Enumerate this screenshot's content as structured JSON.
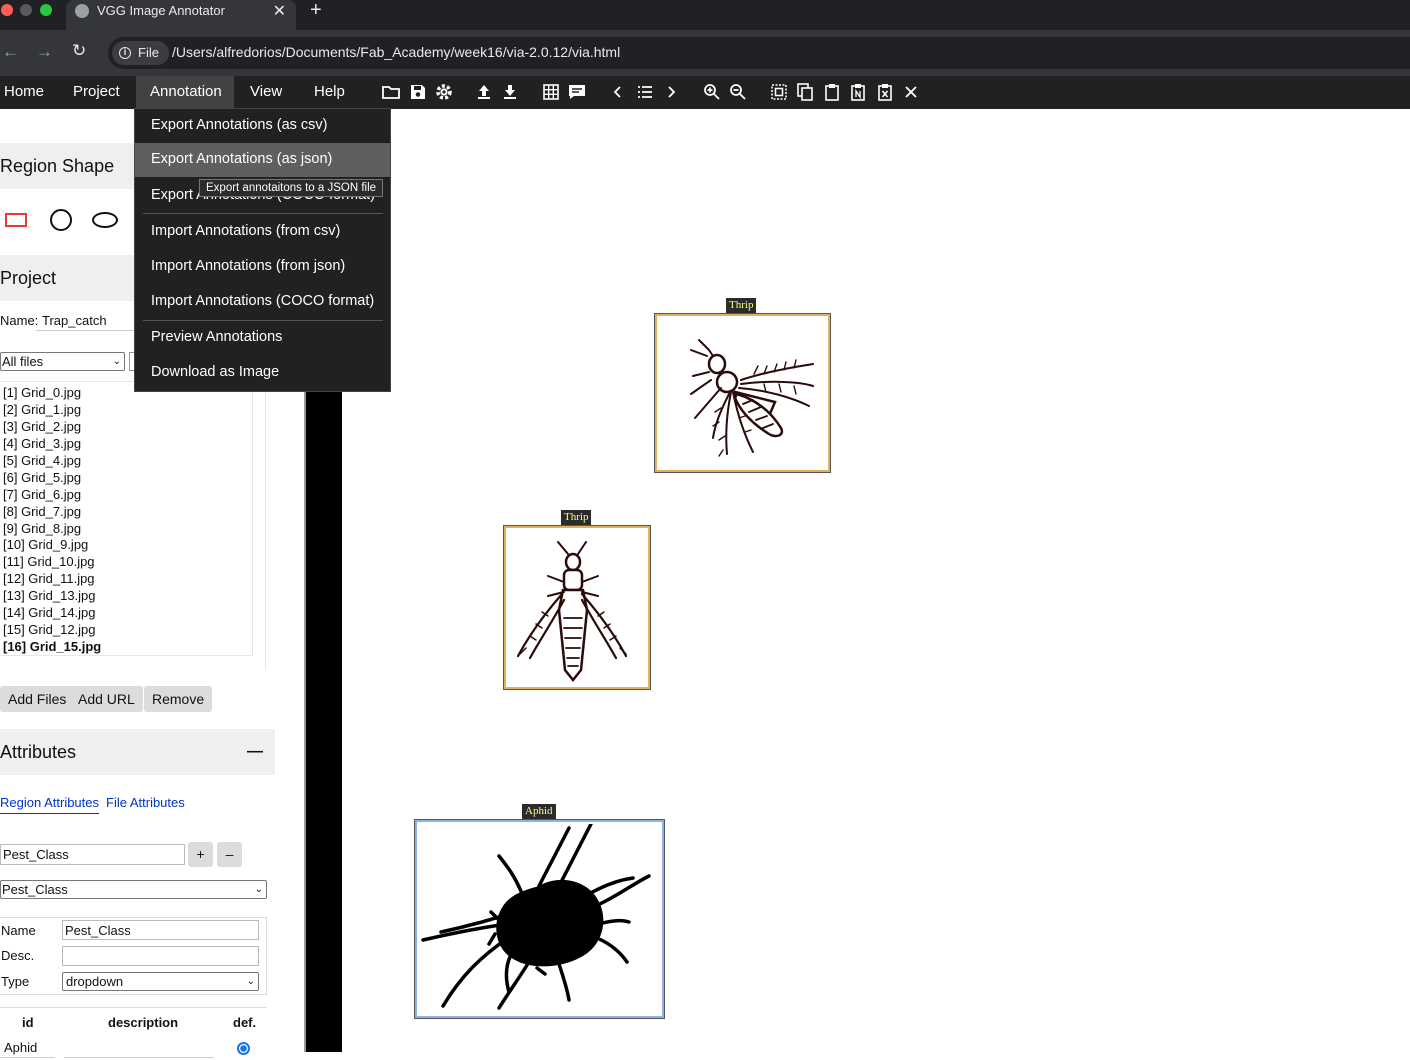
{
  "browser": {
    "tab_title": "VGG Image Annotator",
    "new_tab": "+",
    "file_chip": "File",
    "url": "/Users/alfredorios/Documents/Fab_Academy/week16/via-2.0.12/via.html"
  },
  "nav": {
    "items": [
      "Home",
      "Project",
      "Annotation",
      "View",
      "Help"
    ],
    "active": "Annotation"
  },
  "toolbar_icons": [
    "folder-open-icon",
    "save-icon",
    "settings-icon",
    "upload-icon",
    "download-icon",
    "grid-icon",
    "comment-icon",
    "prev-icon",
    "list-icon",
    "next-icon",
    "zoom-in-icon",
    "zoom-out-icon",
    "select-all-icon",
    "copy-icon",
    "paste-icon",
    "paste-n-icon",
    "delete-region-icon",
    "close-icon"
  ],
  "annotation_menu": {
    "items": [
      "Export Annotations (as csv)",
      "Export Annotations (as json)",
      "Export Annotations (COCO format)",
      "Import Annotations (from csv)",
      "Import Annotations (from json)",
      "Import Annotations (COCO format)",
      "Preview Annotations",
      "Download as Image"
    ],
    "highlighted": "Export Annotations (as json)",
    "tooltip": "Export annotaitons to a JSON file"
  },
  "left": {
    "region_shape_title": "Region Shape",
    "project_title": "Project",
    "name_label": "Name:",
    "name_value": "Trap_catch",
    "filter_value": "All files",
    "files": [
      "[1] Grid_0.jpg",
      "[2] Grid_1.jpg",
      "[3] Grid_2.jpg",
      "[4] Grid_3.jpg",
      "[5] Grid_4.jpg",
      "[6] Grid_5.jpg",
      "[7] Grid_6.jpg",
      "[8] Grid_7.jpg",
      "[9] Grid_8.jpg",
      "[10] Grid_9.jpg",
      "[11] Grid_10.jpg",
      "[12] Grid_11.jpg",
      "[13] Grid_13.jpg",
      "[14] Grid_14.jpg",
      "[15] Grid_12.jpg",
      "[16] Grid_15.jpg"
    ],
    "current_file": "[16] Grid_15.jpg",
    "buttons": {
      "add_files": "Add Files",
      "add_url": "Add URL",
      "remove": "Remove"
    },
    "attributes_title": "Attributes",
    "collapse": "—",
    "tab_region": "Region Attributes",
    "tab_file": "File Attributes",
    "attr_input": "Pest_Class",
    "plus": "+",
    "minus": "–",
    "attr_select": "Pest_Class",
    "name_field_label": "Name",
    "name_field_value": "Pest_Class",
    "desc_label": "Desc.",
    "type_label": "Type",
    "type_value": "dropdown",
    "table_headers": {
      "id": "id",
      "description": "description",
      "def": "def."
    },
    "row_id": "Aphid"
  },
  "regions": [
    {
      "label": "Thrip"
    },
    {
      "label": "Thrip"
    },
    {
      "label": "Aphid"
    }
  ]
}
